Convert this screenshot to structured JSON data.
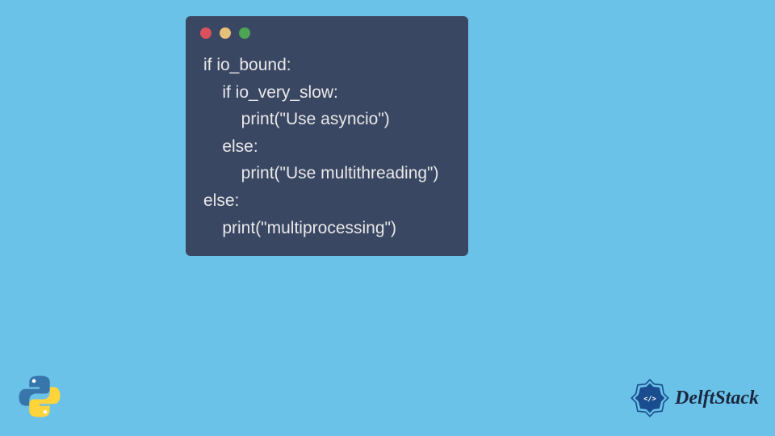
{
  "code": {
    "lines": [
      "if io_bound:",
      "    if io_very_slow:",
      "        print(\"Use asyncio\")",
      "    else:",
      "        print(\"Use multithreading\")",
      "else:",
      "    print(\"multiprocessing\")"
    ]
  },
  "branding": {
    "delftstack": "DelftStack"
  },
  "colors": {
    "background": "#6bc2e8",
    "codeWindow": "#3a4763",
    "codeText": "#e8e8e8",
    "dotRed": "#d9515d",
    "dotYellow": "#e5c07b",
    "dotGreen": "#4ca454",
    "delftBlue": "#1a4d8f"
  }
}
